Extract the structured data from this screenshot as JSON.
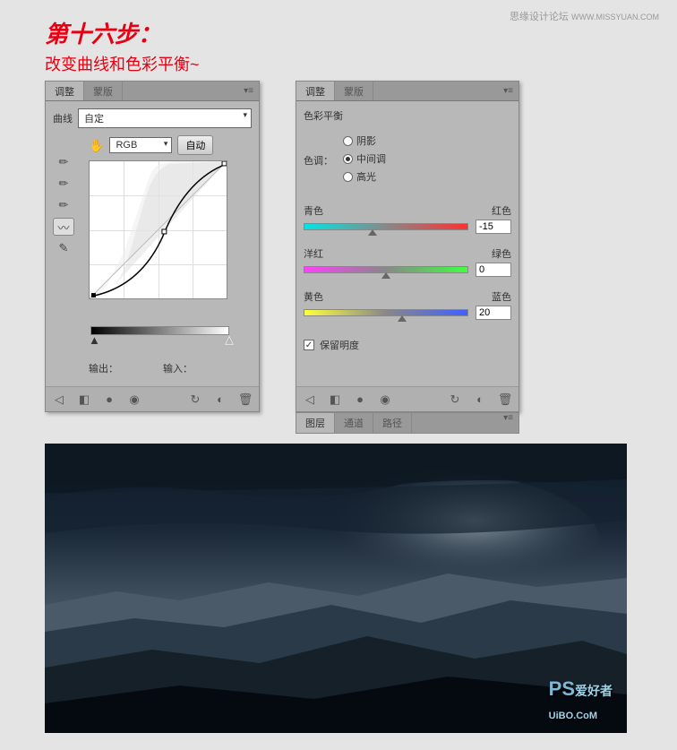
{
  "header": {
    "site": "思缘设计论坛",
    "url": "WWW.MISSYUAN.COM"
  },
  "step": {
    "title": "第十六步：",
    "subtitle": "改变曲线和色彩平衡~"
  },
  "tabs": {
    "adjust": "调整",
    "mask": "蒙版",
    "layers": "图层",
    "channels": "通道",
    "paths": "路径"
  },
  "curves": {
    "label": "曲线",
    "preset": "自定",
    "channel": "RGB",
    "auto_btn": "自动",
    "output_label": "输出：",
    "input_label": "输入："
  },
  "color_balance": {
    "title": "色彩平衡",
    "tone_label": "色调：",
    "tones": {
      "shadows": "阴影",
      "midtones": "中间调",
      "highlights": "高光"
    },
    "sliders": [
      {
        "left": "青色",
        "right": "红色",
        "value": "-15",
        "pos": 42
      },
      {
        "left": "洋红",
        "right": "绿色",
        "value": "0",
        "pos": 50
      },
      {
        "left": "黄色",
        "right": "蓝色",
        "value": "20",
        "pos": 60
      }
    ],
    "preserve_lum": "保留明度"
  },
  "watermark": {
    "en": "PS",
    "cn": "爱好者",
    "sub": "UiBO.CoM"
  }
}
